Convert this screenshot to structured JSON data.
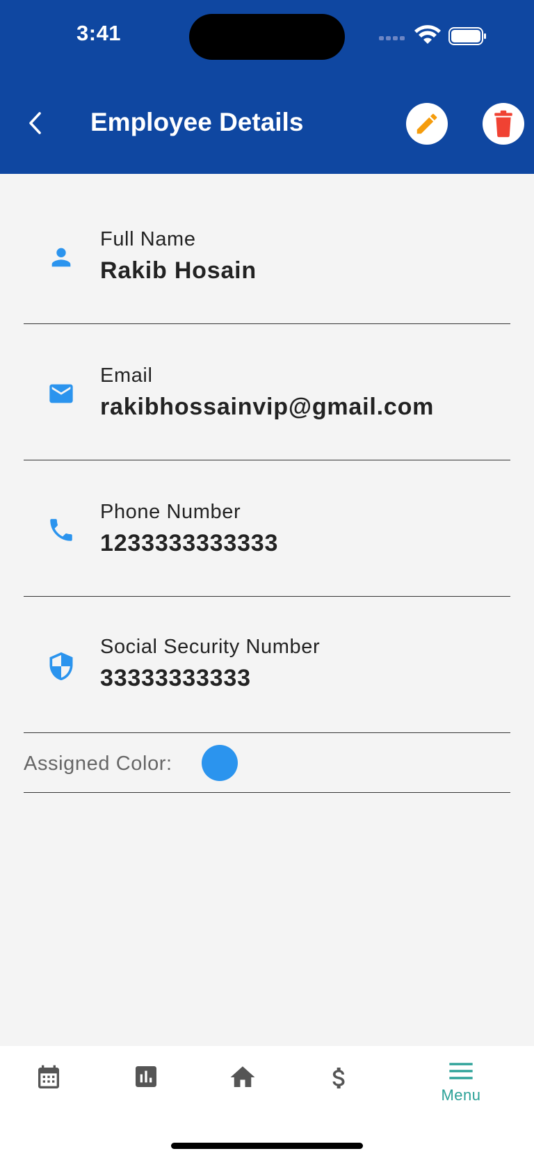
{
  "status_bar": {
    "time": "3:41"
  },
  "header": {
    "title": "Employee Details"
  },
  "fields": [
    {
      "label": "Full Name",
      "value": "Rakib Hosain",
      "icon": "person-icon"
    },
    {
      "label": "Email",
      "value": "rakibhossainvip@gmail.com",
      "icon": "mail-icon"
    },
    {
      "label": "Phone Number",
      "value": "1233333333333",
      "icon": "phone-icon"
    },
    {
      "label": "Social Security Number",
      "value": "33333333333",
      "icon": "shield-icon"
    }
  ],
  "assigned_color": {
    "label": "Assigned Color:",
    "color": "#2b94ee"
  },
  "bottom_nav": {
    "items": [
      {
        "icon": "calendar-icon"
      },
      {
        "icon": "bar-chart-icon"
      },
      {
        "icon": "home-icon"
      },
      {
        "icon": "dollar-icon"
      },
      {
        "icon": "menu-icon",
        "label": "Menu",
        "active": true
      }
    ]
  },
  "colors": {
    "header": "#0f47a1",
    "accent": "#2b94ee",
    "edit": "#f59c0c",
    "delete": "#f04233",
    "nav_active": "#2ba197"
  }
}
